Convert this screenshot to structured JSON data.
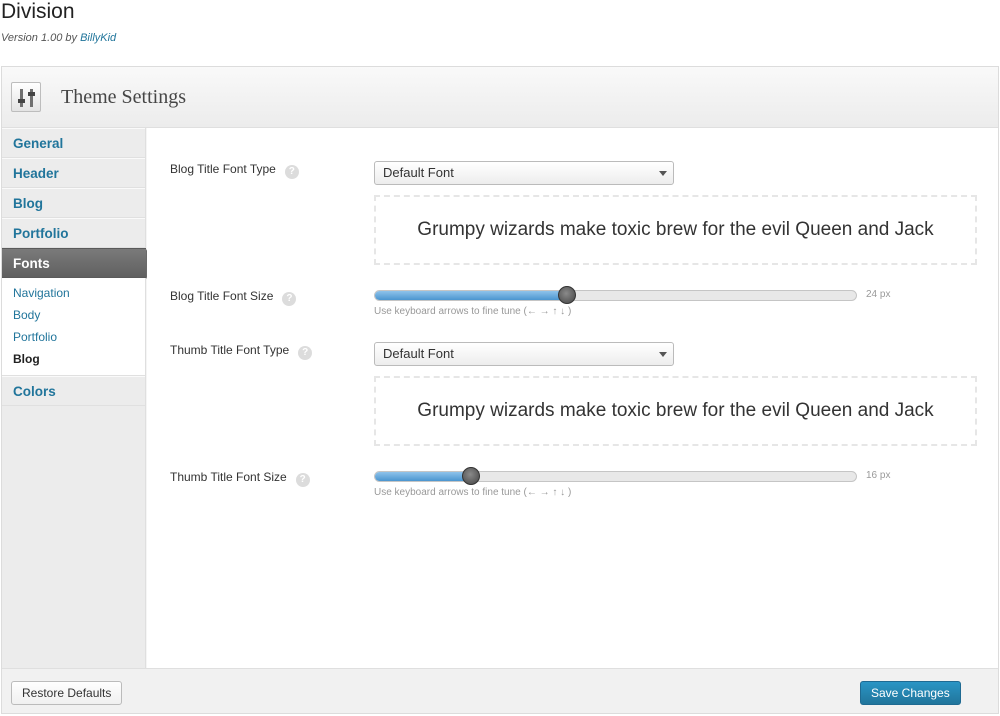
{
  "theme": {
    "name": "Division",
    "version_prefix": "Version 1.00 by",
    "author": "BillyKid"
  },
  "panel": {
    "title": "Theme Settings",
    "icon": "sliders-icon"
  },
  "sidebar": {
    "items": [
      {
        "label": "General"
      },
      {
        "label": "Header"
      },
      {
        "label": "Blog"
      },
      {
        "label": "Portfolio"
      },
      {
        "label": "Fonts"
      },
      {
        "label": "Colors"
      }
    ],
    "active": "Fonts",
    "sub_items": [
      {
        "label": "Navigation"
      },
      {
        "label": "Body"
      },
      {
        "label": "Portfolio"
      },
      {
        "label": "Blog"
      }
    ],
    "current_sub": "Blog"
  },
  "settings": {
    "blog_font_type": {
      "label": "Blog Title Font Type",
      "value": "Default Font",
      "help": "?"
    },
    "blog_preview": {
      "text": "Grumpy wizards make toxic brew for the evil Queen and Jack"
    },
    "blog_font_size": {
      "label": "Blog Title Font Size",
      "value_text": "24 px",
      "value": 24,
      "min": 8,
      "max": 48,
      "help": "?"
    },
    "thumb_font_type": {
      "label": "Thumb Title Font Type",
      "value": "Default Font",
      "help": "?"
    },
    "thumb_preview": {
      "text": "Grumpy wizards make toxic brew for the evil Queen and Jack"
    },
    "thumb_font_size": {
      "label": "Thumb Title Font Size",
      "value_text": "16 px",
      "value": 16,
      "min": 8,
      "max": 48,
      "help": "?"
    },
    "slider_hint": "Use keyboard arrows to fine tune (← → ↑ ↓ )"
  },
  "footer": {
    "restore_label": "Restore Defaults",
    "save_label": "Save Changes"
  },
  "colors": {
    "link": "#21759b",
    "primary_button": "#21759b",
    "slider_fill": "#4b96cf",
    "active_nav": "#6a6a6a"
  }
}
